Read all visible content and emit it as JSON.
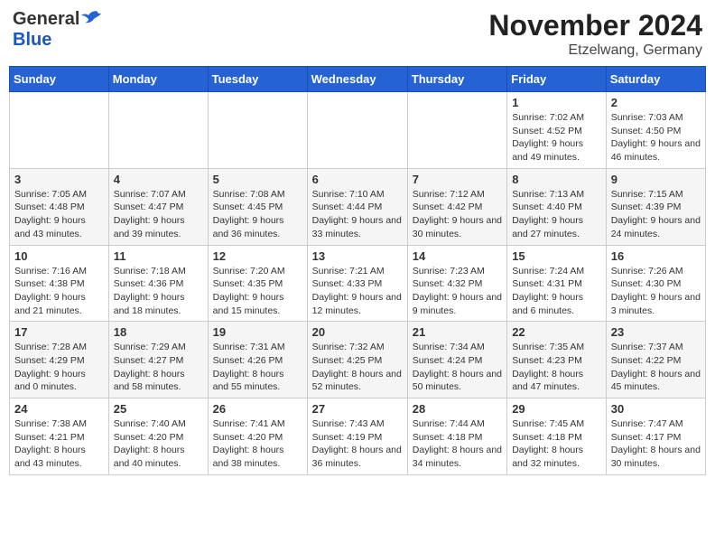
{
  "header": {
    "logo_general": "General",
    "logo_blue": "Blue",
    "month": "November 2024",
    "location": "Etzelwang, Germany"
  },
  "weekdays": [
    "Sunday",
    "Monday",
    "Tuesday",
    "Wednesday",
    "Thursday",
    "Friday",
    "Saturday"
  ],
  "weeks": [
    [
      {
        "day": "",
        "info": ""
      },
      {
        "day": "",
        "info": ""
      },
      {
        "day": "",
        "info": ""
      },
      {
        "day": "",
        "info": ""
      },
      {
        "day": "",
        "info": ""
      },
      {
        "day": "1",
        "info": "Sunrise: 7:02 AM\nSunset: 4:52 PM\nDaylight: 9 hours\nand 49 minutes."
      },
      {
        "day": "2",
        "info": "Sunrise: 7:03 AM\nSunset: 4:50 PM\nDaylight: 9 hours\nand 46 minutes."
      }
    ],
    [
      {
        "day": "3",
        "info": "Sunrise: 7:05 AM\nSunset: 4:48 PM\nDaylight: 9 hours\nand 43 minutes."
      },
      {
        "day": "4",
        "info": "Sunrise: 7:07 AM\nSunset: 4:47 PM\nDaylight: 9 hours\nand 39 minutes."
      },
      {
        "day": "5",
        "info": "Sunrise: 7:08 AM\nSunset: 4:45 PM\nDaylight: 9 hours\nand 36 minutes."
      },
      {
        "day": "6",
        "info": "Sunrise: 7:10 AM\nSunset: 4:44 PM\nDaylight: 9 hours\nand 33 minutes."
      },
      {
        "day": "7",
        "info": "Sunrise: 7:12 AM\nSunset: 4:42 PM\nDaylight: 9 hours\nand 30 minutes."
      },
      {
        "day": "8",
        "info": "Sunrise: 7:13 AM\nSunset: 4:40 PM\nDaylight: 9 hours\nand 27 minutes."
      },
      {
        "day": "9",
        "info": "Sunrise: 7:15 AM\nSunset: 4:39 PM\nDaylight: 9 hours\nand 24 minutes."
      }
    ],
    [
      {
        "day": "10",
        "info": "Sunrise: 7:16 AM\nSunset: 4:38 PM\nDaylight: 9 hours\nand 21 minutes."
      },
      {
        "day": "11",
        "info": "Sunrise: 7:18 AM\nSunset: 4:36 PM\nDaylight: 9 hours\nand 18 minutes."
      },
      {
        "day": "12",
        "info": "Sunrise: 7:20 AM\nSunset: 4:35 PM\nDaylight: 9 hours\nand 15 minutes."
      },
      {
        "day": "13",
        "info": "Sunrise: 7:21 AM\nSunset: 4:33 PM\nDaylight: 9 hours\nand 12 minutes."
      },
      {
        "day": "14",
        "info": "Sunrise: 7:23 AM\nSunset: 4:32 PM\nDaylight: 9 hours\nand 9 minutes."
      },
      {
        "day": "15",
        "info": "Sunrise: 7:24 AM\nSunset: 4:31 PM\nDaylight: 9 hours\nand 6 minutes."
      },
      {
        "day": "16",
        "info": "Sunrise: 7:26 AM\nSunset: 4:30 PM\nDaylight: 9 hours\nand 3 minutes."
      }
    ],
    [
      {
        "day": "17",
        "info": "Sunrise: 7:28 AM\nSunset: 4:29 PM\nDaylight: 9 hours\nand 0 minutes."
      },
      {
        "day": "18",
        "info": "Sunrise: 7:29 AM\nSunset: 4:27 PM\nDaylight: 8 hours\nand 58 minutes."
      },
      {
        "day": "19",
        "info": "Sunrise: 7:31 AM\nSunset: 4:26 PM\nDaylight: 8 hours\nand 55 minutes."
      },
      {
        "day": "20",
        "info": "Sunrise: 7:32 AM\nSunset: 4:25 PM\nDaylight: 8 hours\nand 52 minutes."
      },
      {
        "day": "21",
        "info": "Sunrise: 7:34 AM\nSunset: 4:24 PM\nDaylight: 8 hours\nand 50 minutes."
      },
      {
        "day": "22",
        "info": "Sunrise: 7:35 AM\nSunset: 4:23 PM\nDaylight: 8 hours\nand 47 minutes."
      },
      {
        "day": "23",
        "info": "Sunrise: 7:37 AM\nSunset: 4:22 PM\nDaylight: 8 hours\nand 45 minutes."
      }
    ],
    [
      {
        "day": "24",
        "info": "Sunrise: 7:38 AM\nSunset: 4:21 PM\nDaylight: 8 hours\nand 43 minutes."
      },
      {
        "day": "25",
        "info": "Sunrise: 7:40 AM\nSunset: 4:20 PM\nDaylight: 8 hours\nand 40 minutes."
      },
      {
        "day": "26",
        "info": "Sunrise: 7:41 AM\nSunset: 4:20 PM\nDaylight: 8 hours\nand 38 minutes."
      },
      {
        "day": "27",
        "info": "Sunrise: 7:43 AM\nSunset: 4:19 PM\nDaylight: 8 hours\nand 36 minutes."
      },
      {
        "day": "28",
        "info": "Sunrise: 7:44 AM\nSunset: 4:18 PM\nDaylight: 8 hours\nand 34 minutes."
      },
      {
        "day": "29",
        "info": "Sunrise: 7:45 AM\nSunset: 4:18 PM\nDaylight: 8 hours\nand 32 minutes."
      },
      {
        "day": "30",
        "info": "Sunrise: 7:47 AM\nSunset: 4:17 PM\nDaylight: 8 hours\nand 30 minutes."
      }
    ]
  ]
}
